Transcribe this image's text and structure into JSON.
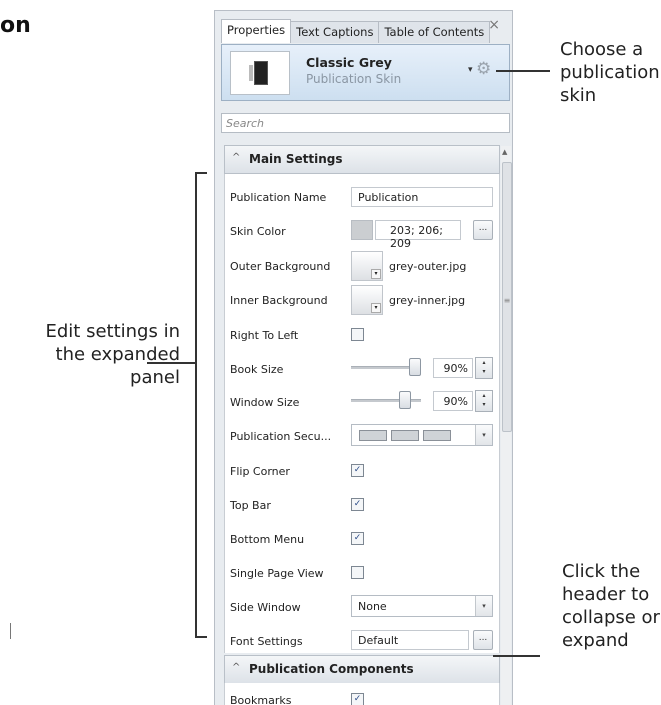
{
  "page": {
    "heading_fragment": "on"
  },
  "callouts": {
    "skin": "Choose a\npublication\nskin",
    "edit": "Edit settings in\nthe expanded\npanel",
    "collapse": "Click the\nheader to\ncollapse or\nexpand"
  },
  "panel": {
    "tabs": [
      "Properties",
      "Text Captions",
      "Table of Contents"
    ],
    "active_tab": "Properties",
    "close_glyph": "×",
    "skin": {
      "name": "Classic Grey",
      "type": "Publication Skin",
      "caret": "▾",
      "gear": "⚙"
    },
    "search": {
      "placeholder": "Search"
    },
    "main_settings": {
      "title": "Main Settings",
      "chevron": "^",
      "publication_name": {
        "label": "Publication Name",
        "value": "Publication"
      },
      "skin_color": {
        "label": "Skin Color",
        "value": "203; 206; 209",
        "swatch": "#cbced1",
        "button": "..."
      },
      "outer_background": {
        "label": "Outer Background",
        "value": "grey-outer.jpg"
      },
      "inner_background": {
        "label": "Inner Background",
        "value": "grey-inner.jpg"
      },
      "right_to_left": {
        "label": "Right To Left",
        "checked": false
      },
      "book_size": {
        "label": "Book Size",
        "value": "90%",
        "level": 0.9
      },
      "window_size": {
        "label": "Window Size",
        "value": "90%",
        "level": 0.75
      },
      "publication_security": {
        "label": "Publication Secu..."
      },
      "flip_corner": {
        "label": "Flip Corner",
        "checked": true
      },
      "top_bar": {
        "label": "Top Bar",
        "checked": true
      },
      "bottom_menu": {
        "label": "Bottom Menu",
        "checked": true
      },
      "single_page_view": {
        "label": "Single Page View",
        "checked": false
      },
      "side_window": {
        "label": "Side Window",
        "value": "None"
      },
      "font_settings": {
        "label": "Font Settings",
        "value": "Default",
        "button": "..."
      }
    },
    "publication_components": {
      "title": "Publication Components",
      "chevron": "^",
      "bookmarks": {
        "label": "Bookmarks",
        "checked": true
      }
    },
    "checkmark": "✓",
    "dropdown_arrow": "▾",
    "spinner": "▴\n▾"
  }
}
